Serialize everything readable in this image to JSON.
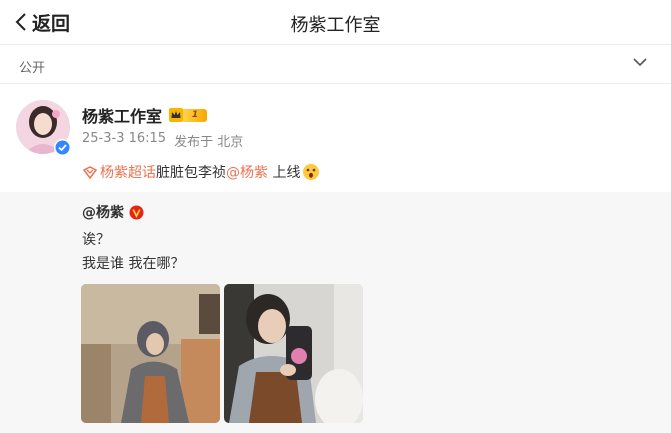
{
  "header": {
    "back_label": "返回",
    "title": "杨紫工作室"
  },
  "visibility": {
    "label": "公开"
  },
  "post": {
    "author": "杨紫工作室",
    "member_level": "1",
    "date": "25-3-3 16:15",
    "location": "发布于 北京",
    "text": {
      "topic": "杨紫超话",
      "middle": "脏脏包李祯",
      "mention": "@杨紫",
      "end": " 上线"
    }
  },
  "quoted": {
    "author": "@杨紫",
    "line1": "诶？",
    "line2": "我是谁 我在哪？"
  },
  "colors": {
    "accent": "#eb7350",
    "verified_blue": "#2f88ff",
    "verified_red": "#e5231b",
    "quote_bg": "#f7f7f7"
  },
  "icons": {
    "back": "chevron-left-icon",
    "expand": "chevron-down-icon",
    "topic": "super-topic-icon",
    "emoji": "surprised-emoji-icon"
  }
}
